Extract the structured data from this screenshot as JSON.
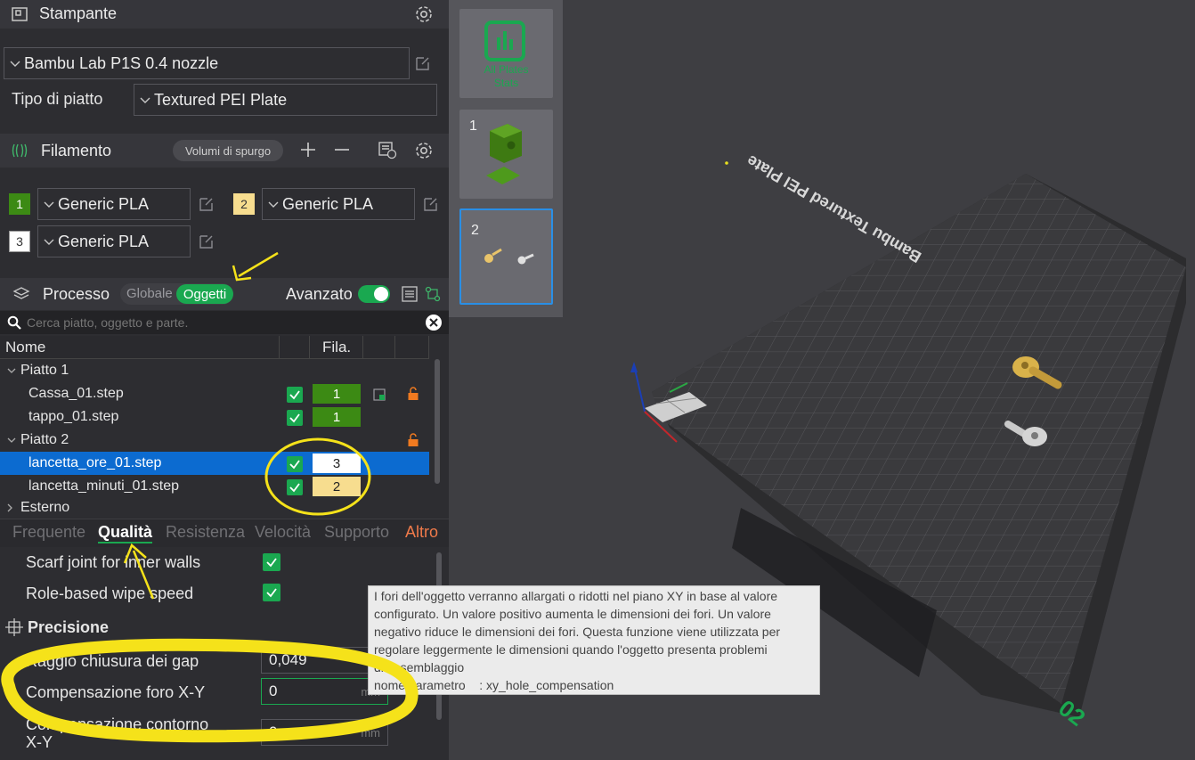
{
  "printer": {
    "title": "Stampante",
    "selected": "Bambu Lab P1S 0.4 nozzle",
    "plate_type_label": "Tipo di piatto",
    "plate_type_value": "Textured PEI Plate"
  },
  "filament": {
    "title": "Filamento",
    "flush_button": "Volumi di spurgo",
    "slots": [
      {
        "index": "1",
        "name": "Generic PLA",
        "color": "#3c8a14"
      },
      {
        "index": "2",
        "name": "Generic PLA",
        "color": "#f7dd8f"
      },
      {
        "index": "3",
        "name": "Generic PLA",
        "color": "#ffffff"
      }
    ]
  },
  "process": {
    "title": "Processo",
    "mode_global": "Globale",
    "mode_objects": "Oggetti",
    "advanced_label": "Avanzato",
    "advanced_on": true
  },
  "search": {
    "placeholder": "Cerca piatto, oggetto e parte."
  },
  "tree": {
    "col_name": "Nome",
    "col_fila": "Fila.",
    "rows": [
      {
        "label": "Piatto 1",
        "type": "group"
      },
      {
        "label": "Cassa_01.step",
        "type": "object",
        "fila": "1"
      },
      {
        "label": "tappo_01.step",
        "type": "object",
        "fila": "1"
      },
      {
        "label": "Piatto 2",
        "type": "group"
      },
      {
        "label": "lancetta_ore_01.step",
        "type": "object",
        "fila": "3",
        "selected": true
      },
      {
        "label": "lancetta_minuti_01.step",
        "type": "object",
        "fila": "2"
      },
      {
        "label": "Esterno",
        "type": "group"
      }
    ]
  },
  "tabs": [
    {
      "label": "Frequente"
    },
    {
      "label": "Qualità",
      "active": true
    },
    {
      "label": "Resistenza"
    },
    {
      "label": "Velocità"
    },
    {
      "label": "Supporto"
    },
    {
      "label": "Altro"
    }
  ],
  "settings": {
    "scarf_label": "Scarf joint for inner walls",
    "role_wipe_label": "Role-based wipe speed",
    "precision_title": "Precisione",
    "gap_label": "Raggio chiusura dei gap",
    "gap_value": "0,049",
    "hole_label": "Compensazione foro X-Y",
    "hole_value": "0",
    "hole_unit": "mm",
    "contour_label": "Compensazione contorno",
    "contour_label2": "X-Y",
    "contour_value": "0",
    "contour_unit": "mm"
  },
  "plates_panel": {
    "stats_label1": "All Plates",
    "stats_label2": "Stats",
    "plate1_num": "1",
    "plate2_num": "2"
  },
  "bed": {
    "label": "Bambu Textured PEI Plate",
    "plate_number": "02"
  },
  "tooltip": {
    "lines": [
      "I fori dell'oggetto verranno allargati o ridotti nel piano XY in base al valore",
      "configurato. Un valore positivo aumenta le dimensioni dei fori. Un valore",
      "negativo riduce le dimensioni dei fori. Questa funzione viene utilizzata per",
      "regolare leggermente le dimensioni quando l'oggetto presenta problemi",
      "di assemblaggio",
      "nome parametro    : xy_hole_compensation"
    ]
  },
  "colors": {
    "accent_green": "#1aa850",
    "selection_blue": "#0c6bd0",
    "annotation_yellow": "#f5e21a"
  }
}
